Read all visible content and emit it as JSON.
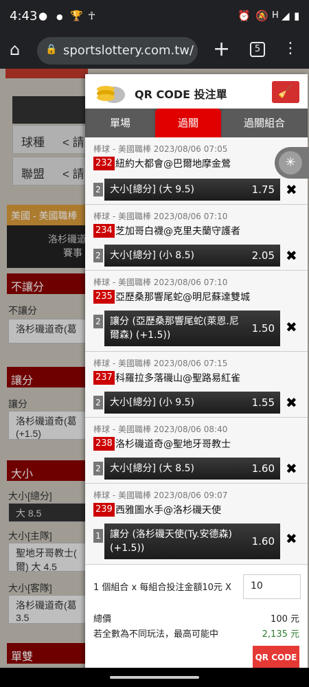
{
  "status": {
    "time": "4:43",
    "left_icons": [
      "chat-bubble-icon",
      "dot-icon",
      "trophy-icon",
      "accessibility-icon"
    ],
    "right_icons": [
      "alarm-icon",
      "mute-icon",
      "signal-icon",
      "battery-icon"
    ],
    "signal": "H"
  },
  "browser": {
    "url": "sportslottery.com.tw/zh",
    "tab_count": "5"
  },
  "background": {
    "rows": [
      {
        "label": "球種",
        "value": "< 請"
      },
      {
        "label": "聯盟",
        "value": "< 請"
      }
    ],
    "league_banner": "美國 - 美國職棒",
    "match_line1": "洛杉磯道",
    "match_line2": "賽事",
    "sections": [
      {
        "title": "不讓分",
        "sub": "不讓分",
        "card": "洛杉磯道奇(葛"
      },
      {
        "title": "讓分",
        "sub": "讓分",
        "card": "洛杉磯道奇(葛 (+1.5)"
      },
      {
        "title": "大小",
        "sub": "大小[總分]",
        "card": "大 8.5"
      }
    ],
    "extra": [
      {
        "sub": "大小[主隊]",
        "card": "聖地牙哥教士( 爾) 大 4.5"
      },
      {
        "sub": "大小[客隊]",
        "card": "洛杉磯道奇(葛 3.5"
      }
    ],
    "bottom_title": "單雙"
  },
  "panel": {
    "title": "QR CODE 投注單",
    "tabs": [
      "單場",
      "過關",
      "過關組合"
    ],
    "bets": [
      {
        "header": "棒球 - 美國職棒 2023/08/06 07:05",
        "num": "232",
        "match": "紐約大都會@巴爾地摩金鶯",
        "odd_tag": "2",
        "selection": "大小[總分] (大 9.5)",
        "odds": "1.75"
      },
      {
        "header": "棒球 - 美國職棒 2023/08/06 07:10",
        "num": "234",
        "match": "芝加哥白襪@克里夫蘭守護者",
        "odd_tag": "2",
        "selection": "大小[總分] (小 8.5)",
        "odds": "2.05"
      },
      {
        "header": "棒球 - 美國職棒 2023/08/06 07:10",
        "num": "235",
        "match": "亞歷桑那響尾蛇@明尼蘇達雙城",
        "odd_tag": "2",
        "selection": "讓分 (亞歷桑那響尾蛇(萊恩.尼爾森) (+1.5))",
        "odds": "1.50"
      },
      {
        "header": "棒球 - 美國職棒 2023/08/06 07:15",
        "num": "237",
        "match": "科羅拉多落磯山@聖路易紅雀",
        "odd_tag": "2",
        "selection": "大小[總分] (小 9.5)",
        "odds": "1.55"
      },
      {
        "header": "棒球 - 美國職棒 2023/08/06 08:40",
        "num": "238",
        "match": "洛杉磯道奇@聖地牙哥教士",
        "odd_tag": "2",
        "selection": "大小[總分] (大 8.5)",
        "odds": "1.60"
      },
      {
        "header": "棒球 - 美國職棒 2023/08/06 09:07",
        "num": "239",
        "match": "西雅圖水手@洛杉磯天使",
        "odd_tag": "1",
        "selection": "讓分 (洛杉磯天使(Ty.安德森) (+1.5))",
        "odds": "1.60"
      }
    ],
    "footer": {
      "combo_label": "1 個組合 x 每組合投注金額10元 X",
      "amount": "10",
      "total_label": "總價",
      "total_value": "100 元",
      "max_label": "若全數為不同玩法，最高可能中",
      "max_value": "2,135 元",
      "qr_button": "QR CODE"
    }
  }
}
